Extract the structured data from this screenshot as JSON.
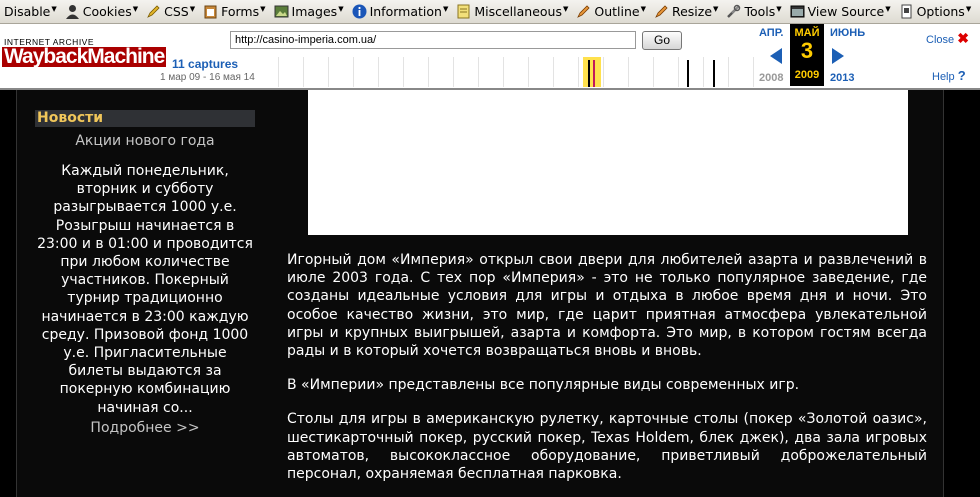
{
  "devbar": {
    "items": [
      "Disable",
      "Cookies",
      "CSS",
      "Forms",
      "Images",
      "Information",
      "Miscellaneous",
      "Outline",
      "Resize",
      "Tools",
      "View Source",
      "Options"
    ]
  },
  "wayback": {
    "logo_top": "INTERNET ARCHIVE",
    "logo_bottom": "WaybackMachine",
    "url": "http://casino-imperia.com.ua/",
    "go": "Go",
    "captures": "11 captures",
    "range": "1 мар 09 - 16 мая 14",
    "prev_month": "АПР.",
    "cur_month": "МАЙ",
    "next_month": "ИЮНЬ",
    "day": "3",
    "prev_year": "2008",
    "cur_year": "2009",
    "next_year": "2013",
    "close": "Close",
    "help": "Help"
  },
  "sidebar": {
    "heading": "Новости",
    "subtitle": "Акции нового года",
    "body": "Каждый понедельник, вторник и субботу разыгрывается 1000 у.е. Розыгрыш начинается в 23:00 и в 01:00 и проводится при любом количестве участников. Покерный турнир традиционно начинается в 23:00 каждую среду. Призовой фонд 1000 у.е. Пригласительные билеты выдаются за покерную комбинацию начиная со...",
    "more": "Подробнее >>"
  },
  "article": {
    "p1": "Игорный дом «Империя» открыл свои двери для любителей азарта и развлечений в июле 2003 года. С тех пор «Империя» - это не только популярное заведение, где созданы идеальные условия для игры и отдыха в любое время дня и ночи. Это особое качество жизни, это мир, где царит приятная атмосфера увлекательной игры и крупных выигрышей, азарта и комфорта. Это мир, в котором гостям всегда рады и в который хочется возвращаться вновь и вновь.",
    "p2": "В «Империи» представлены все популярные виды современных игр.",
    "p3": "Столы для игры в американскую рулетку, карточные столы (покер «Золотой оазис», шестикарточный покер, русский покер, Texas Holdem, блек джек), два зала игровых автоматов, высококлассное оборудование, приветливый доброжелательный персонал, охраняемая бесплатная парковка."
  },
  "colors": {
    "link_blue": "#1c5fb5",
    "news_gold": "#f0c65a",
    "cal_yellow": "#ffcc00"
  }
}
